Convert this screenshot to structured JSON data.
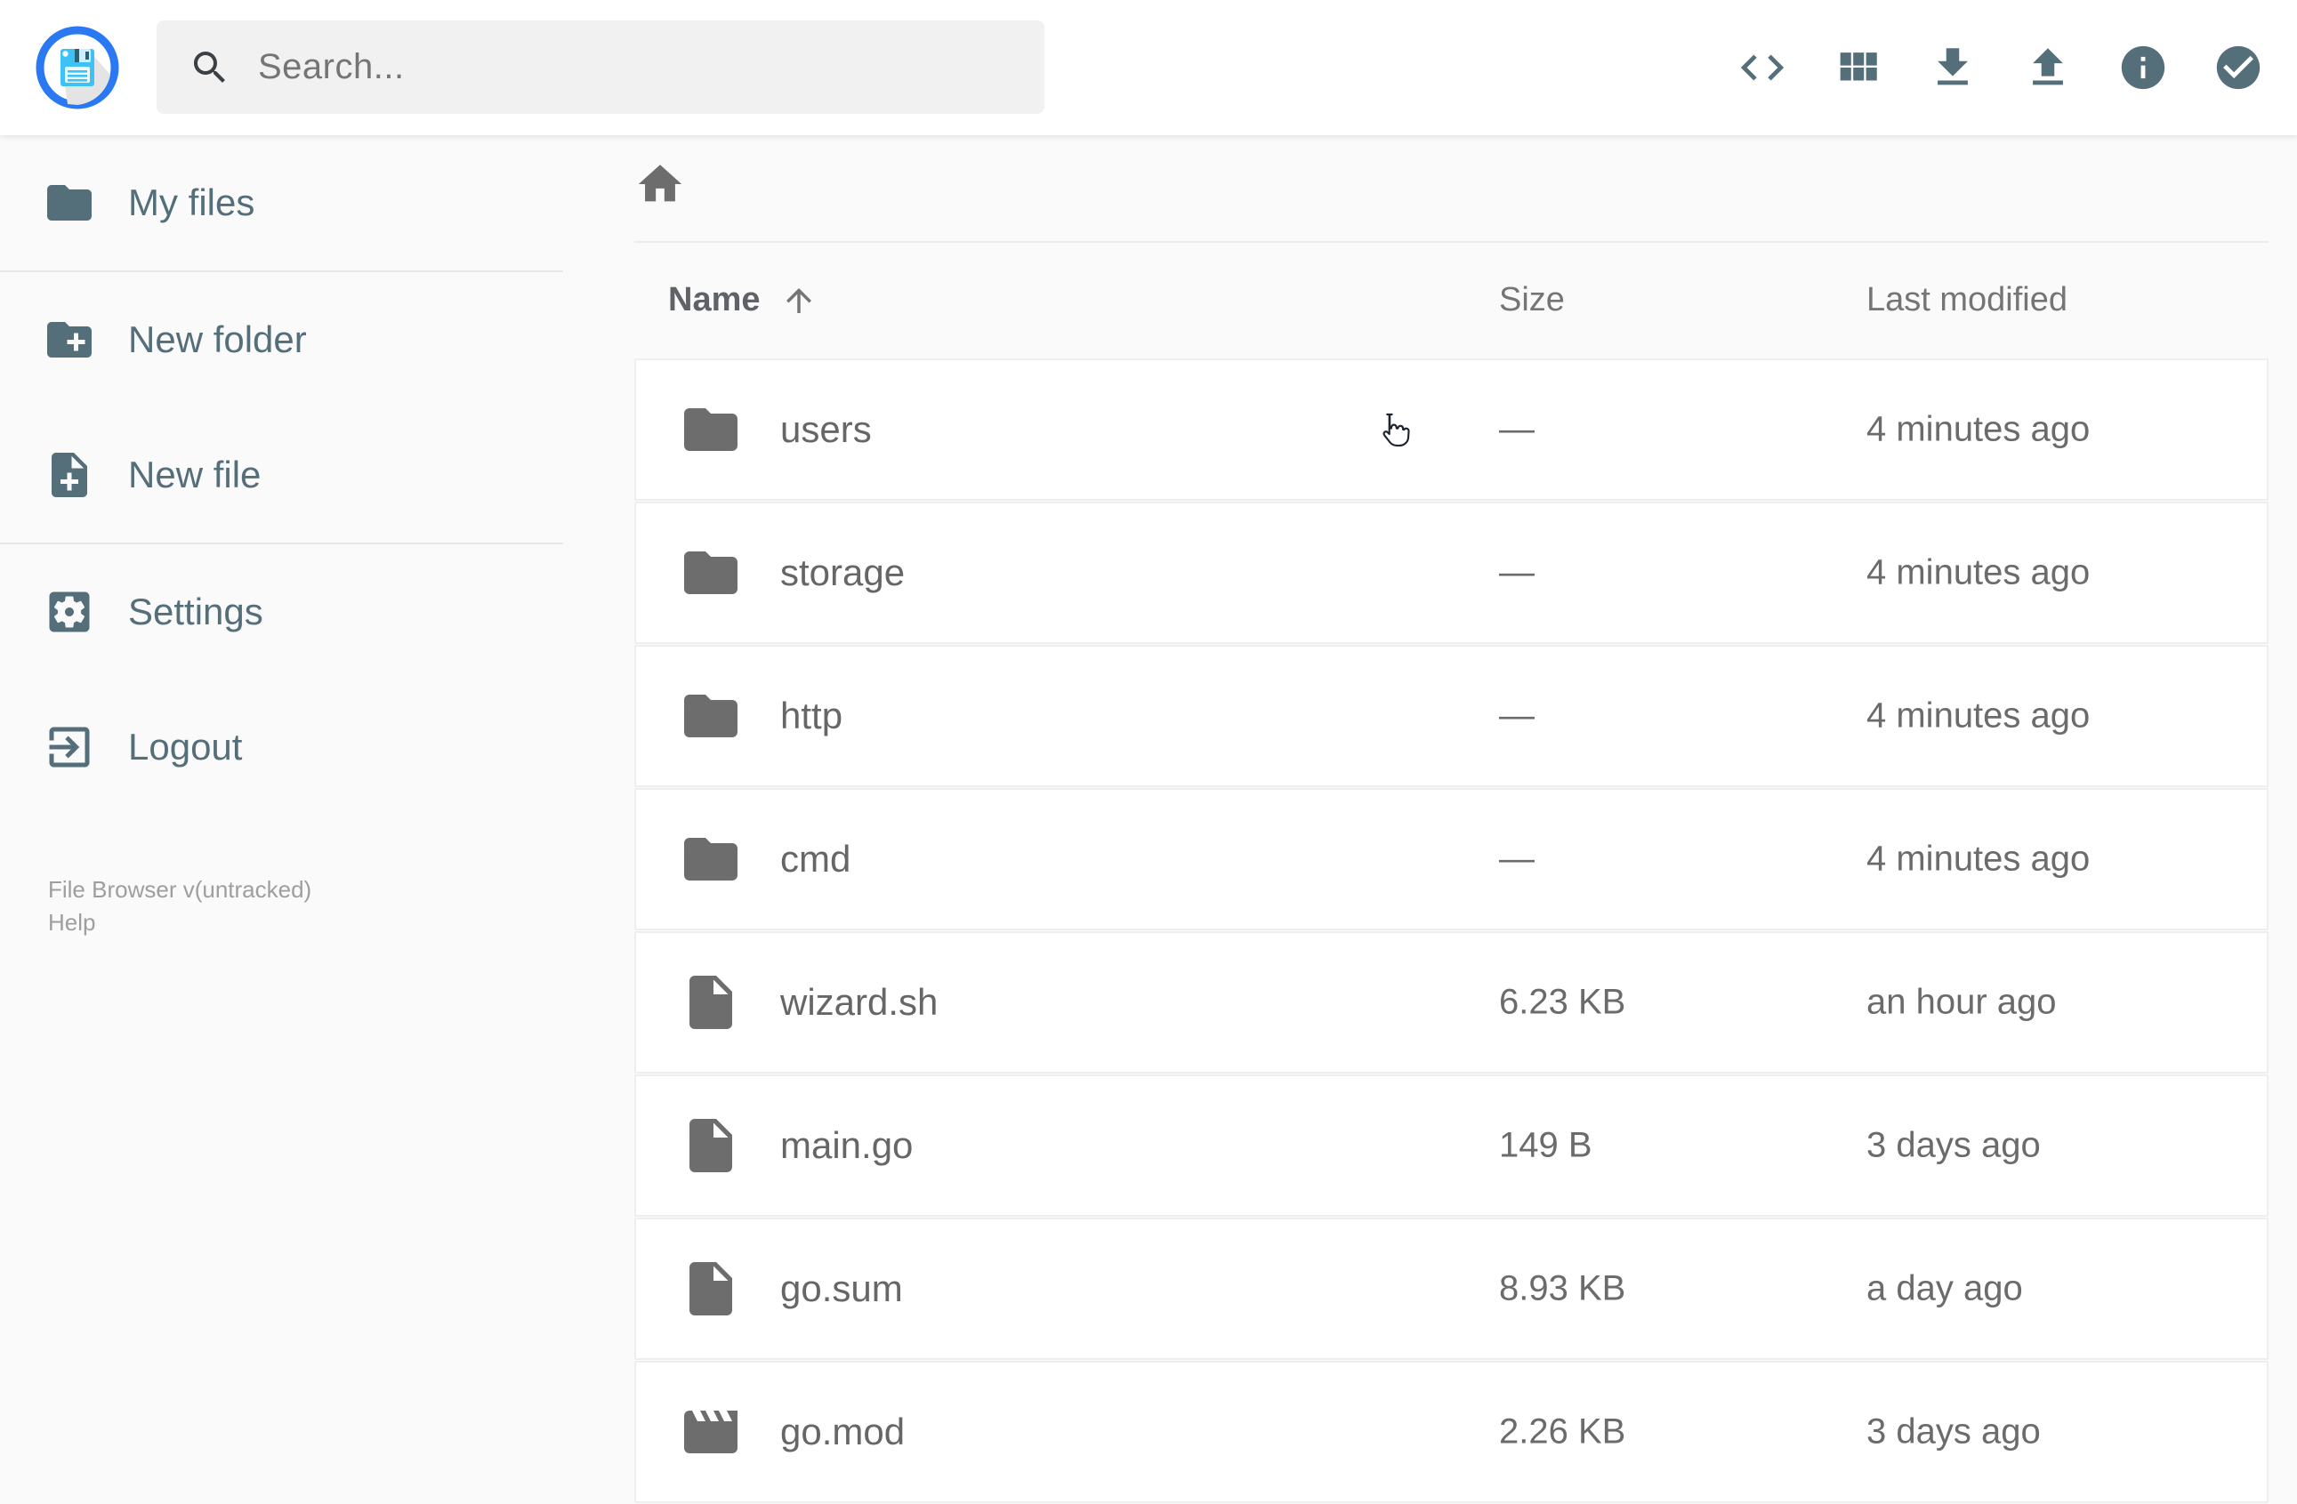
{
  "header": {
    "search": {
      "placeholder": "Search..."
    },
    "toolbar": [
      {
        "icon": "code-icon"
      },
      {
        "icon": "grid-view-icon"
      },
      {
        "icon": "download-icon"
      },
      {
        "icon": "upload-icon"
      },
      {
        "icon": "info-icon"
      },
      {
        "icon": "check-circle-icon"
      }
    ]
  },
  "sidebar": {
    "items": [
      {
        "label": "My files",
        "icon": "folder-icon",
        "divider_after": true
      },
      {
        "label": "New folder",
        "icon": "new-folder-icon",
        "divider_after": false
      },
      {
        "label": "New file",
        "icon": "new-file-icon",
        "divider_after": true
      },
      {
        "label": "Settings",
        "icon": "settings-icon",
        "divider_after": false
      },
      {
        "label": "Logout",
        "icon": "logout-icon",
        "divider_after": false
      }
    ],
    "footer": {
      "version": "File Browser v(untracked)",
      "help": "Help"
    }
  },
  "main": {
    "columns": {
      "name": "Name",
      "size": "Size",
      "modified": "Last modified"
    },
    "sort": {
      "column": "Name",
      "direction": "asc"
    },
    "rows": [
      {
        "icon": "folder-icon",
        "name": "users",
        "size": "—",
        "modified": "4 minutes ago"
      },
      {
        "icon": "folder-icon",
        "name": "storage",
        "size": "—",
        "modified": "4 minutes ago"
      },
      {
        "icon": "folder-icon",
        "name": "http",
        "size": "—",
        "modified": "4 minutes ago"
      },
      {
        "icon": "folder-icon",
        "name": "cmd",
        "size": "—",
        "modified": "4 minutes ago"
      },
      {
        "icon": "file-icon",
        "name": "wizard.sh",
        "size": "6.23 KB",
        "modified": "an hour ago"
      },
      {
        "icon": "file-icon",
        "name": "main.go",
        "size": "149 B",
        "modified": "3 days ago"
      },
      {
        "icon": "file-icon",
        "name": "go.sum",
        "size": "8.93 KB",
        "modified": "a day ago"
      },
      {
        "icon": "movie-icon",
        "name": "go.mod",
        "size": "2.26 KB",
        "modified": "3 days ago"
      }
    ]
  },
  "colors": {
    "accent_slate": "#546E7A",
    "logo_ring_blue": "#2a79f3",
    "logo_disk_blue": "#3ec1f5",
    "row_icon_gray": "#6d6d6d",
    "text_gray": "#666666",
    "header_gray": "#757575",
    "page_bg": "#fafafa"
  }
}
